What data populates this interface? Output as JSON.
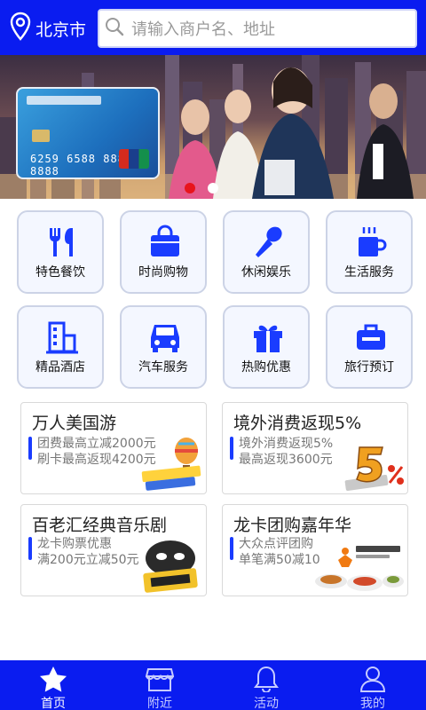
{
  "header": {
    "city": "北京市",
    "search_placeholder": "请输入商户名、地址"
  },
  "banner": {
    "card_number": "6259 6588 8888 8888",
    "slides_total": 2,
    "slide_active": 1
  },
  "categories": [
    {
      "label": "特色餐饮",
      "icon": "fork-knife-icon"
    },
    {
      "label": "时尚购物",
      "icon": "shopping-bag-icon"
    },
    {
      "label": "休闲娱乐",
      "icon": "microphone-icon"
    },
    {
      "label": "生活服务",
      "icon": "mug-icon"
    },
    {
      "label": "精品酒店",
      "icon": "hotel-building-icon"
    },
    {
      "label": "汽车服务",
      "icon": "car-icon"
    },
    {
      "label": "热购优惠",
      "icon": "gift-icon"
    },
    {
      "label": "旅行预订",
      "icon": "luggage-icon"
    }
  ],
  "promos": [
    {
      "title": "万人美国游",
      "lines": [
        "团费最高立减2000元",
        "刷卡最高返现4200元"
      ]
    },
    {
      "title": "境外消费返现5%",
      "lines": [
        "境外消费返现5%",
        "最高返现3600元"
      ]
    },
    {
      "title": "百老汇经典音乐剧",
      "lines": [
        "龙卡购票优惠",
        "满200元立减50元"
      ]
    },
    {
      "title": "龙卡团购嘉年华",
      "lines": [
        "大众点评团购",
        "单笔满50减10"
      ]
    }
  ],
  "tabs": [
    {
      "label": "首页",
      "icon": "star-icon",
      "active": true
    },
    {
      "label": "附近",
      "icon": "storefront-icon",
      "active": false
    },
    {
      "label": "活动",
      "icon": "bell-icon",
      "active": false
    },
    {
      "label": "我的",
      "icon": "user-icon",
      "active": false
    }
  ],
  "colors": {
    "brand_blue": "#0a1cf0",
    "accent_red": "#e8141c",
    "icon_blue": "#1a3cff"
  }
}
